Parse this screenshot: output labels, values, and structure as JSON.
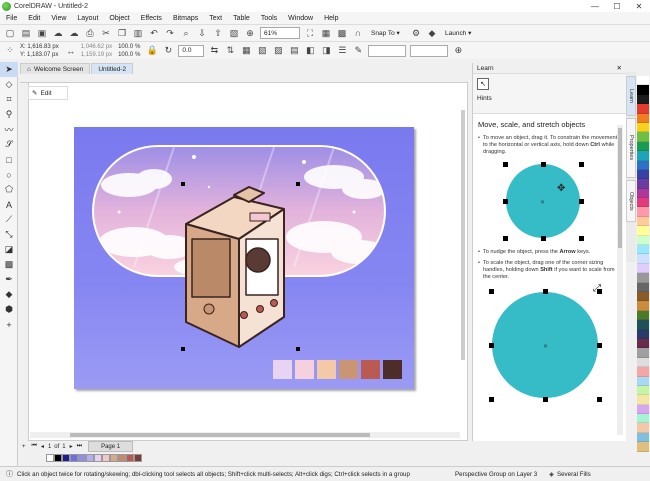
{
  "window": {
    "title": "CorelDRAW - Untitled-2"
  },
  "menu": [
    "File",
    "Edit",
    "View",
    "Layout",
    "Object",
    "Effects",
    "Bitmaps",
    "Text",
    "Table",
    "Tools",
    "Window",
    "Help"
  ],
  "toolbar": {
    "zoom": "61%",
    "snap": "Snap To",
    "launch": "Launch"
  },
  "propbar": {
    "x": "X: 1,616.83 px",
    "y": "Y: 1,183.07 px",
    "w": "1,046.62 px",
    "h": "1,159.19 px",
    "sx": "100.0",
    "sy": "100.0",
    "angle": "0.0",
    "pct": "%"
  },
  "tabs": {
    "welcome": "Welcome Screen",
    "doc": "Untitled-2"
  },
  "canvas": {
    "edit": "Edit"
  },
  "pages": {
    "count": "1",
    "of": "of",
    "label": "Page 1"
  },
  "docker": {
    "title": "Learn",
    "hints": "Hints",
    "heading": "Move, scale, and stretch objects",
    "p1a": "To move an object, drag it. To constrain the movement to the horizontal or vertical axis, hold down ",
    "p1b": "Ctrl",
    "p1c": " while dragging.",
    "p2a": "To nudge the object, press the ",
    "p2b": "Arrow",
    "p2c": " keys.",
    "p3a": "To scale the object, drag one of the corner sizing handles, holding down ",
    "p3b": "Shift",
    "p3c": " if you want to scale from the center.",
    "side": [
      "Learn",
      "Properties",
      "Objects"
    ]
  },
  "status": {
    "hint": "Click an object twice for rotating/skewing; dbl-clicking tool selects all objects; Shift+click multi-selects; Alt+click digs; Ctrl+click selects in a group",
    "layer": "Perspective Group on Layer 3",
    "fills": "Several Fills"
  },
  "accent": {
    "teal": "#35bcc6",
    "page": "#8080f0"
  },
  "doc_palette": [
    "#ffffff",
    "#000000",
    "#1f1f8a",
    "#6e6ee0",
    "#8f8fe8",
    "#b0b0f0",
    "#e7d3f0",
    "#f2c7c7",
    "#d3ab8c",
    "#c28a68",
    "#b85a52",
    "#7a3c35"
  ],
  "swatches": [
    "#e8d3f2",
    "#f4d1dc",
    "#f3c9a8",
    "#c99572",
    "#b95b53",
    "#4e2c28"
  ],
  "palette": [
    "#ffffff",
    "#000000",
    "#1b1b1b",
    "#e33b2e",
    "#f07d1f",
    "#f7d21a",
    "#6fbf43",
    "#1a9a52",
    "#1ca4b8",
    "#2f6fc6",
    "#3442a8",
    "#6b3aa2",
    "#b0369c",
    "#e23a7a",
    "#ff99aa",
    "#ffcc99",
    "#ffff99",
    "#ccffcc",
    "#99e6ff",
    "#cce0ff",
    "#e0ccff",
    "#999999",
    "#666666",
    "#8b5a2b",
    "#c98c3d",
    "#4a7a2a",
    "#20505a",
    "#2a3a6a",
    "#6a2a4a",
    "#a0a0a0",
    "#dddddd",
    "#f4a6a6",
    "#a6d9f4",
    "#c8f4a6",
    "#f4e6a6",
    "#d6a6f4",
    "#a6f4d6",
    "#f4c8a6",
    "#7fbfdf",
    "#dfbf7f"
  ]
}
